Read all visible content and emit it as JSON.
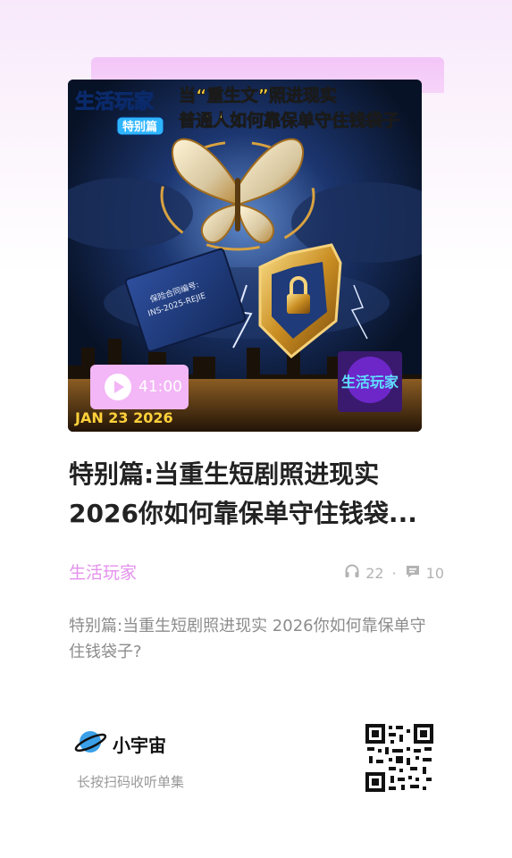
{
  "cover": {
    "show_name_badge": "生活玩家",
    "special_badge": "特别篇",
    "headline_line1": "当“重生文”照进现实",
    "headline_line2": "普通人如何靠保单守住钱袋子",
    "book_label_line1": "保险合同编号:",
    "book_label_line2": "INS-2025-REJIE",
    "date": "JAN 23 2026",
    "logo_text": "生活玩家"
  },
  "player": {
    "duration": "41:00"
  },
  "episode": {
    "title": "特别篇:当重生短剧照进现实 2026你如何靠保单守住钱袋...",
    "podcast": "生活玩家",
    "listens": "22",
    "separator": "·",
    "comments": "10",
    "description": "特别篇:当重生短剧照进现实 2026你如何靠保单守住钱袋子?"
  },
  "footer": {
    "brand": "小宇宙",
    "hint": "长按扫码收听单集"
  },
  "colors": {
    "accent_pink": "#e491ec",
    "play_pill": "#f3b6f6",
    "title": "#222222",
    "muted": "#8c8c8c"
  }
}
